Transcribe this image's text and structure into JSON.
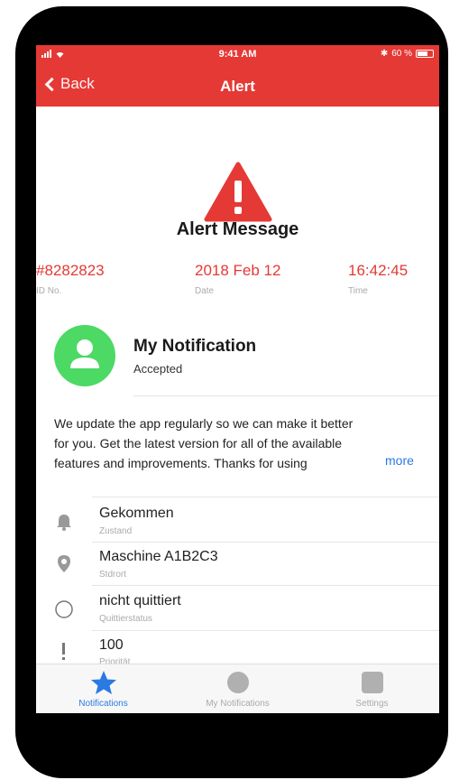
{
  "status_bar": {
    "time": "9:41 AM",
    "battery": "60 %"
  },
  "nav": {
    "back_label": "Back",
    "title": "Alert"
  },
  "alert": {
    "title": "Alert Message"
  },
  "meta": [
    {
      "value": "#8282823",
      "label": "ID No."
    },
    {
      "value": "2018 Feb 12",
      "label": "Date"
    },
    {
      "value": "16:42:45",
      "label": "Time"
    }
  ],
  "notification": {
    "title": "My Notification",
    "status": "Accepted"
  },
  "description": {
    "lines": [
      "We update the app regularly so we can make it better",
      "for you. Get the latest version for all of the available",
      "features and improvements. Thanks for using"
    ],
    "more_label": "more"
  },
  "details": [
    {
      "icon": "bell-icon",
      "title": "Gekommen",
      "subtitle": "Zustand"
    },
    {
      "icon": "location-pin-icon",
      "title": "Maschine A1B2C3",
      "subtitle": "Stdrort"
    },
    {
      "icon": "circle-icon",
      "title": "nicht quittiert",
      "subtitle": "Quittierstatus"
    },
    {
      "icon": "exclamation-icon",
      "title": "100",
      "subtitle": "Priorität"
    }
  ],
  "tabs": [
    {
      "icon": "star-icon",
      "label": "Notifications",
      "active": true
    },
    {
      "icon": "circle-icon",
      "label": "My Notifications",
      "active": false
    },
    {
      "icon": "square-icon",
      "label": "Settings",
      "active": false
    }
  ],
  "colors": {
    "accent": "#e53935",
    "success": "#4cd964",
    "link": "#2a7ae2"
  }
}
